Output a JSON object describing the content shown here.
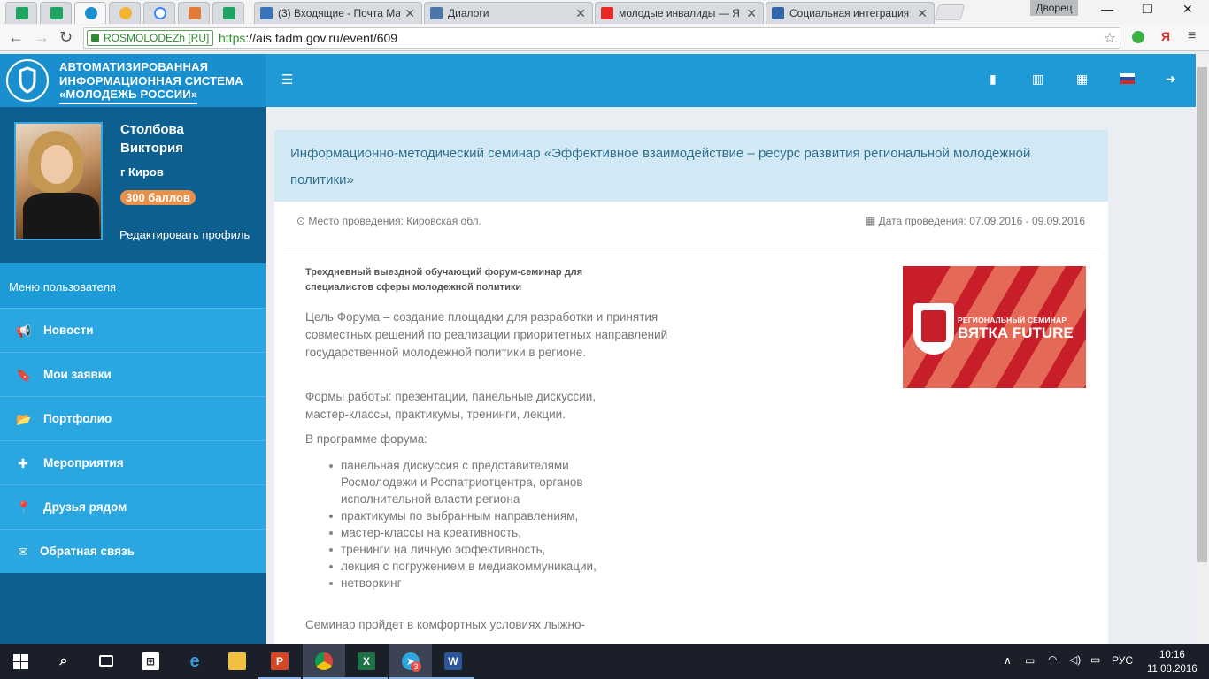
{
  "browser": {
    "tabs": [
      {
        "title": "(3) Входящие - Почта Ма",
        "favicon_color": "#3b73b9"
      },
      {
        "title": "Диалоги",
        "favicon_color": "#4a76a8"
      },
      {
        "title": "молодые инвалиды — Я",
        "favicon_color": "#e62a2a"
      },
      {
        "title": "Социальная интеграция",
        "favicon_color": "#3466a6"
      }
    ],
    "user_chip": "Дворец",
    "ev_badge": "ROSMOLODEZh [RU]",
    "url_scheme": "https",
    "url_rest": "://ais.fadm.gov.ru/event/609"
  },
  "brand": {
    "line1": "АВТОМАТИЗИРОВАННАЯ",
    "line2": "ИНФОРМАЦИОННАЯ СИСТЕМА",
    "line3": "«МОЛОДЕЖЬ РОССИИ»"
  },
  "profile": {
    "first_line": "Столбова",
    "second_line": "Виктория",
    "city": "г Киров",
    "points": "300 баллов",
    "edit": "Редактировать профиль"
  },
  "menu": {
    "header": "Меню пользователя",
    "items": [
      {
        "label": "Новости",
        "icon": "megaphone-icon"
      },
      {
        "label": "Мои заявки",
        "icon": "bookmark-icon"
      },
      {
        "label": "Портфолио",
        "icon": "folder-open-icon"
      },
      {
        "label": "Мероприятия",
        "icon": "puzzle-icon"
      },
      {
        "label": "Друзья рядом",
        "icon": "map-marker-icon"
      },
      {
        "label": "Обратная связь",
        "icon": "envelope-icon"
      }
    ]
  },
  "event": {
    "title": "Информационно-методический семинар «Эффективное взаимодействие – ресурс развития региональной молодёжной политики»",
    "place": "Место проведения: Кировская обл.",
    "dates": "Дата проведения: 07.09.2016 - 09.09.2016",
    "lead": "Трехдневный выездной обучающий форум-семинар для специалистов сферы молодежной политики",
    "goal": "Цель Форума – создание площадки для разработки и принятия совместных решений по реализации приоритетных направлений государственной молодежной политики в регионе.",
    "forms": "Формы работы: презентации, панельные дискуссии, мастер-классы, практикумы, тренинги, лекции.",
    "program_intro": "В программе форума:",
    "program": [
      "панельная дискуссия с представителями Росмолодежи и Роспатриотцентра, органов исполнительной власти региона",
      "практикумы по выбранным направлениям,",
      "мастер-классы на креативность,",
      "тренинги на личную эффективность,",
      "лекция с погружением в медиакоммуникации,",
      "нетворкинг"
    ],
    "footer_text": "Семинар пройдет в комфортных условиях лыжно-",
    "banner_small": "РЕГИОНАЛЬНЫЙ СЕМИНАР",
    "banner_big": "ВЯТКА FUTURE"
  },
  "taskbar": {
    "lang": "РУС",
    "time": "10:16",
    "date": "11.08.2016",
    "telegram_badge": "3"
  },
  "colors": {
    "brand_blue": "#1a8fcf",
    "menu_blue": "#2aa6e0",
    "profile_dark": "#0c5f8f",
    "points_orange": "#e8904a",
    "title_bg": "#d2e9f5"
  }
}
